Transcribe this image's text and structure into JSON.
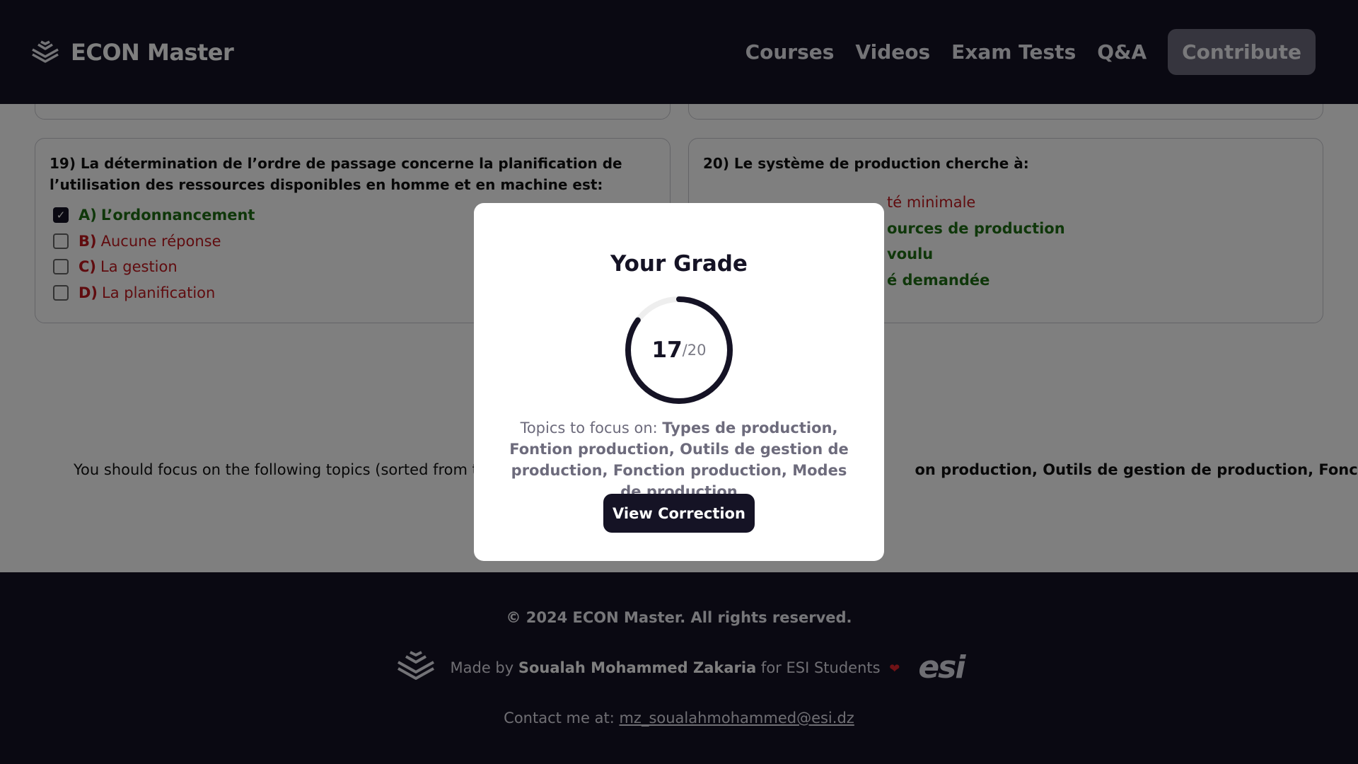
{
  "header": {
    "brand": "ECON Master",
    "nav": [
      "Courses",
      "Videos",
      "Exam Tests",
      "Q&A"
    ],
    "cta": "Contribute"
  },
  "questions": [
    {
      "text": "19) La détermination de l’ordre de passage concerne la planification de l’utilisation des ressources disponibles en homme et en machine est:",
      "options": [
        {
          "letter": "A)",
          "text": "L’ordonnancement",
          "checked": true,
          "status": "correct"
        },
        {
          "letter": "B)",
          "text": "Aucune réponse",
          "checked": false,
          "status": "wrong"
        },
        {
          "letter": "C)",
          "text": "La gestion",
          "checked": false,
          "status": "wrong"
        },
        {
          "letter": "D)",
          "text": "La planification",
          "checked": false,
          "status": "wrong"
        }
      ]
    },
    {
      "text": "20) Le système de production cherche à:",
      "options": [
        {
          "text": "té minimale",
          "status": "wrong"
        },
        {
          "text": "ources de production",
          "status": "correct"
        },
        {
          "text": "voulu",
          "status": "correct"
        },
        {
          "text": "é demandée",
          "status": "correct"
        }
      ]
    }
  ],
  "focus_line": {
    "prefix": "You should focus on the following topics (sorted from the",
    "suffix": "on production, Outils de gestion de production, Fonction"
  },
  "modal": {
    "title": "Your Grade",
    "score": "17",
    "total": "20",
    "progress": 0.85,
    "topics_label": "Topics to focus on:",
    "topics": "Types de production, Fontion production, Outils de gestion de production, Fonction production, Modes de production",
    "button": "View Correction"
  },
  "footer": {
    "copyright": "© 2024 ECON Master. All rights reserved.",
    "made_prefix": "Made by",
    "author": "Soualah Mohammed Zakaria",
    "made_suffix": "for ESI Students",
    "esi": "esi",
    "contact_label": "Contact me at:",
    "email": "mz_soualahmohammed@esi.dz"
  },
  "colors": {
    "dark": "#151325",
    "correct": "#1f6f14",
    "wrong": "#c0191f",
    "heart": "#e0252c"
  },
  "icons": [
    "layers-logo-icon",
    "checkmark-icon",
    "heart-icon",
    "esi-logo"
  ]
}
